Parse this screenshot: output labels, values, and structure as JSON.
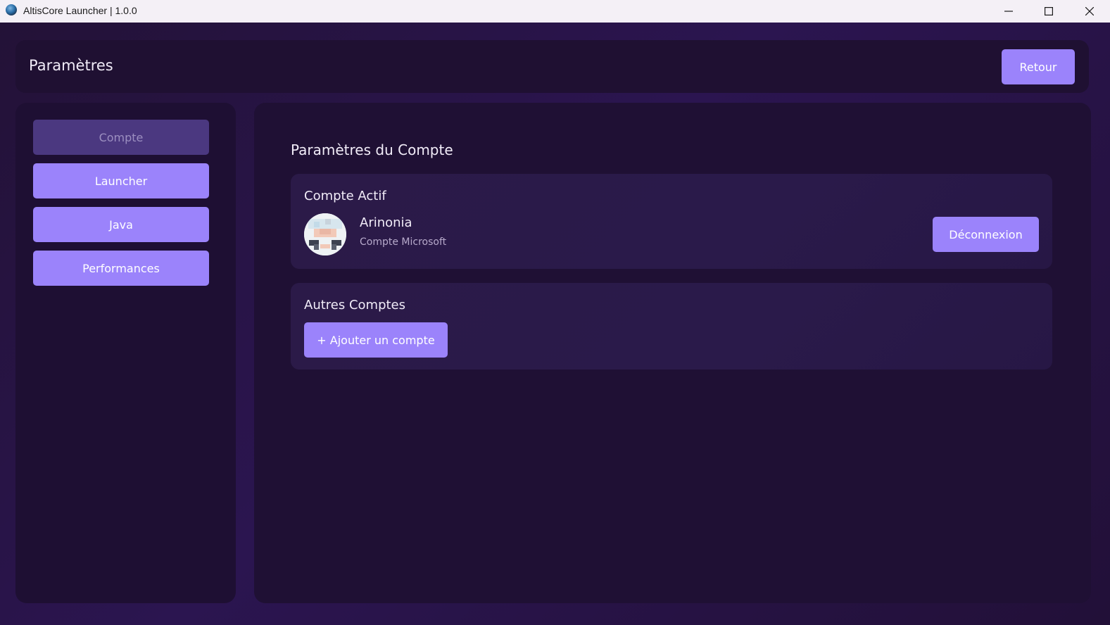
{
  "window": {
    "title": "AltisCore Launcher | 1.0.0",
    "icons": {
      "app": "globe-icon",
      "minimize": "minimize-icon",
      "maximize": "maximize-icon",
      "close": "close-icon"
    }
  },
  "header": {
    "title": "Paramètres",
    "back_label": "Retour"
  },
  "sidebar": {
    "items": [
      {
        "label": "Compte",
        "active": true
      },
      {
        "label": "Launcher",
        "active": false
      },
      {
        "label": "Java",
        "active": false
      },
      {
        "label": "Performances",
        "active": false
      }
    ]
  },
  "main": {
    "title": "Paramètres du Compte",
    "active_account": {
      "heading": "Compte Actif",
      "name": "Arinonia",
      "type": "Compte Microsoft",
      "logout_label": "Déconnexion"
    },
    "other_accounts": {
      "heading": "Autres Comptes",
      "add_label": "+ Ajouter un compte"
    }
  },
  "colors": {
    "accent": "#9b83fb",
    "accent_active": "#4b3880",
    "panel": "#1f1034",
    "card": "#2b1a48",
    "titlebar": "#f4f0f6"
  }
}
